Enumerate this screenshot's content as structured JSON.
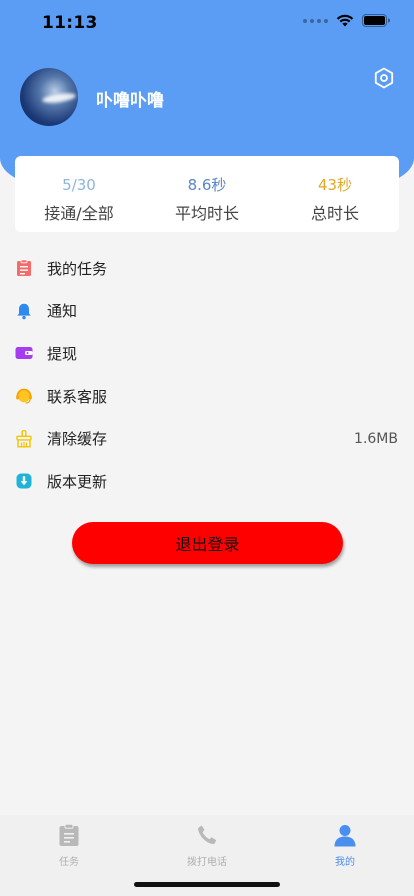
{
  "status_bar": {
    "time": "11:13"
  },
  "profile": {
    "username": "卟噜卟噜"
  },
  "stats": [
    {
      "value": "5/30",
      "label": "接通/全部",
      "color": "#8db5dc"
    },
    {
      "value": "8.6秒",
      "label": "平均时长",
      "color": "#5b86c4"
    },
    {
      "value": "43秒",
      "label": "总时长",
      "color": "#e0a92a"
    }
  ],
  "menu": [
    {
      "label": "我的任务",
      "icon": "clipboard-icon",
      "value": ""
    },
    {
      "label": "通知",
      "icon": "bell-icon",
      "value": ""
    },
    {
      "label": "提现",
      "icon": "wallet-icon",
      "value": ""
    },
    {
      "label": "联系客服",
      "icon": "headset-icon",
      "value": ""
    },
    {
      "label": "清除缓存",
      "icon": "cache-icon",
      "value": "1.6MB"
    },
    {
      "label": "版本更新",
      "icon": "update-icon",
      "value": ""
    }
  ],
  "logout_label": "退出登录",
  "tabs": [
    {
      "label": "任务",
      "icon": "task-icon",
      "active": false
    },
    {
      "label": "拨打电话",
      "icon": "phone-icon",
      "active": false
    },
    {
      "label": "我的",
      "icon": "person-icon",
      "active": true
    }
  ],
  "colors": {
    "header": "#5b9cf4",
    "logout": "#ff0000",
    "tab_active": "#4a8ef0",
    "tab_inactive": "#b0b0b0"
  }
}
